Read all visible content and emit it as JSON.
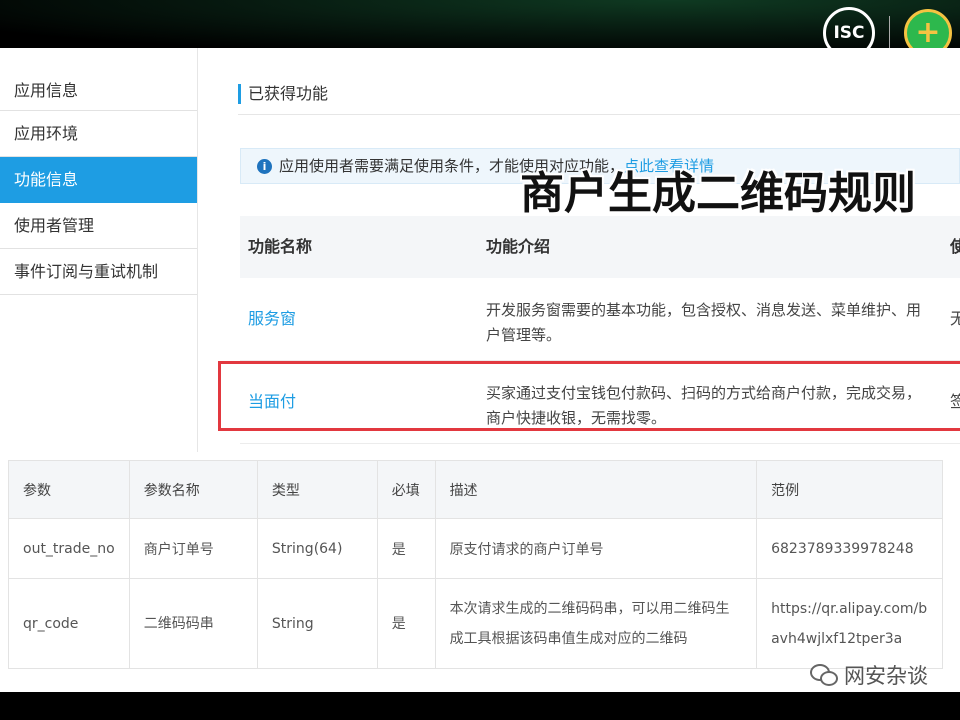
{
  "logos": {
    "isc": "ISC",
    "q360": "+"
  },
  "sidebar": {
    "items": [
      {
        "label": "应用信息",
        "active": false
      },
      {
        "label": "应用环境",
        "active": false
      },
      {
        "label": "功能信息",
        "active": true
      },
      {
        "label": "使用者管理",
        "active": false
      },
      {
        "label": "事件订阅与重试机制",
        "active": false
      }
    ]
  },
  "content": {
    "section_title": "已获得功能",
    "notice": {
      "icon": "i",
      "text": "应用使用者需要满足使用条件，才能使用对应功能，",
      "link": "点此查看详情"
    },
    "overlay_title": "商户生成二维码规则",
    "features": {
      "headers": [
        "功能名称",
        "功能介绍",
        "使"
      ],
      "rows": [
        {
          "name": "服务窗",
          "desc": "开发服务窗需要的基本功能，包含授权、消息发送、菜单维护、用户管理等。",
          "extra": "无"
        },
        {
          "name": "当面付",
          "desc": "买家通过支付宝钱包付款码、扫码的方式给商户付款，完成交易，商户快捷收银，无需找零。",
          "extra": "签"
        }
      ]
    }
  },
  "params": {
    "headers": [
      "参数",
      "参数名称",
      "类型",
      "必填",
      "描述",
      "范例"
    ],
    "rows": [
      [
        "out_trade_no",
        "商户订单号",
        "String(64)",
        "是",
        "原支付请求的商户订单号",
        "6823789339978248"
      ],
      [
        "qr_code",
        "二维码码串",
        "String",
        "是",
        "本次请求生成的二维码码串，可以用二维码生成工具根据该码串值生成对应的二维码",
        "https://qr.alipay.com/bavh4wjlxf12tper3a"
      ]
    ]
  },
  "watermark": "网安杂谈",
  "colors": {
    "accent": "#1e9de3",
    "highlight": "#e2383f"
  }
}
